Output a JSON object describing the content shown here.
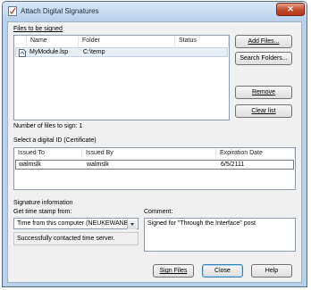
{
  "window": {
    "title": "Attach Digital Signatures",
    "close_glyph": "✕"
  },
  "files": {
    "section_label": "Files to be signed",
    "columns": [
      "Name",
      "Folder",
      "Status"
    ],
    "rows": [
      {
        "name": "MyModule.lsp",
        "folder": "C:\\temp",
        "status": "",
        "icon": "lisp-file-icon"
      }
    ],
    "count_label": "Number of files to sign: 1"
  },
  "buttons": {
    "add_files": "Add Files...",
    "search_folders": "Search Folders...",
    "remove": "Remove",
    "clear_list": "Clear list",
    "sign_files": "Sign Files",
    "close": "Close",
    "help": "Help"
  },
  "certificate": {
    "section_label": "Select a digital ID (Certificate)",
    "columns": [
      "Issued To",
      "Issued By",
      "Expiration Date"
    ],
    "rows": [
      {
        "issued_to": "walmslk",
        "issued_by": "walmslk",
        "expiration": "6/5/2111"
      }
    ]
  },
  "signature": {
    "section_label": "Signature information",
    "timestamp_label": "Get time stamp from:",
    "timestamp_value": "Time from this computer (NEUKEWANB1",
    "status_text": "Successfully contacted time server.",
    "comment_label": "Comment:",
    "comment_value": "Signed for \"Through the Interface\" post"
  }
}
